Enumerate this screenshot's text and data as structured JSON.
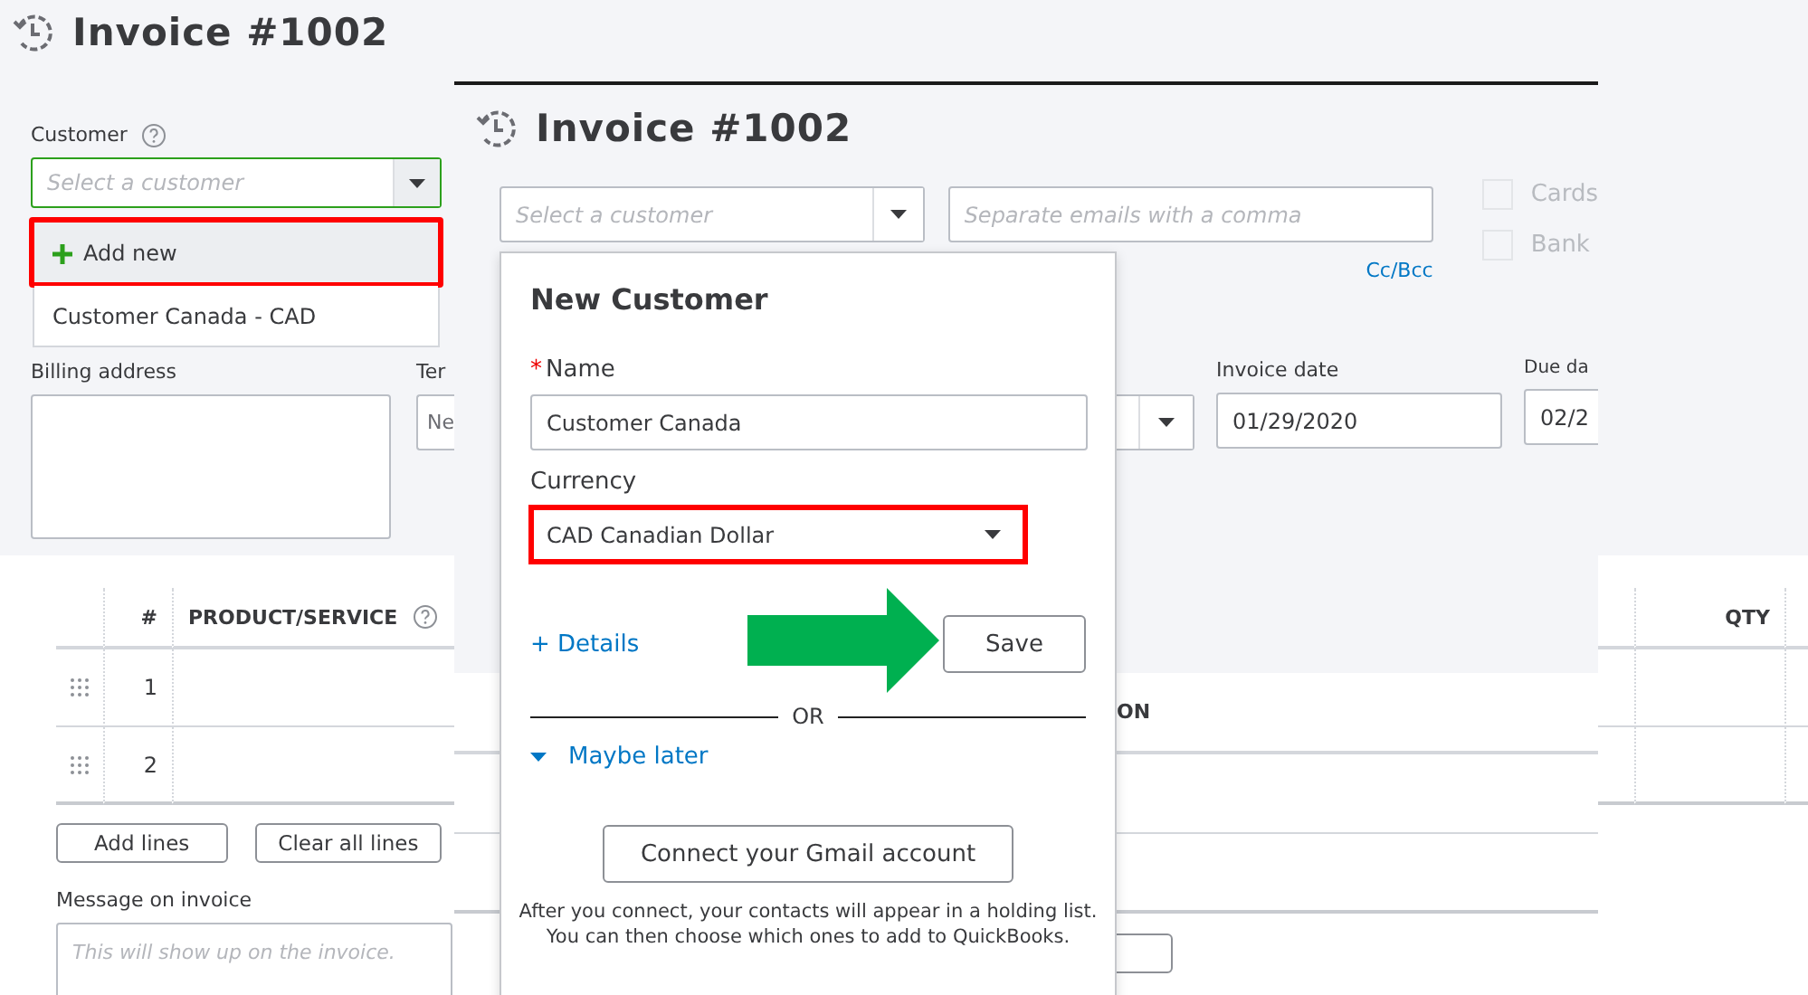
{
  "background_screen": {
    "title": "Invoice #1002",
    "customer": {
      "label": "Customer",
      "placeholder": "Select a customer",
      "dropdown": [
        {
          "label": "Add new",
          "kind": "add",
          "highlighted": true
        },
        {
          "label": "Customer Canada - CAD",
          "kind": "option",
          "highlighted": false
        }
      ]
    },
    "billing_address": {
      "label": "Billing address"
    },
    "terms": {
      "label": "Ter",
      "value": "Ne"
    },
    "table": {
      "columns": [
        "#",
        "PRODUCT/SERVICE",
        "QTY"
      ],
      "rows": [
        {
          "number": "1"
        },
        {
          "number": "2"
        }
      ]
    },
    "buttons": [
      "Add lines",
      "Clear all lines"
    ],
    "message": {
      "label": "Message on invoice",
      "placeholder": "This will show up on the invoice."
    }
  },
  "overlay_screen": {
    "title": "Invoice #1002",
    "customer_placeholder": "Select a customer",
    "email_placeholder": "Separate emails with a comma",
    "cc_bcc": "Cc/Bcc",
    "payment_options": [
      {
        "label": "Cards",
        "checked": false
      },
      {
        "label": "Bank",
        "checked": false
      }
    ],
    "invoice_date": {
      "label": "Invoice date",
      "value": "01/29/2020"
    },
    "due_date": {
      "label": "Due da",
      "value": "02/2"
    },
    "table_header": "ON",
    "dialog": {
      "title": "New Customer",
      "name": {
        "label": "Name",
        "required_mark": "*",
        "value": "Customer Canada"
      },
      "currency": {
        "label": "Currency",
        "value": "CAD Canadian Dollar",
        "highlighted": true
      },
      "details_link": "+ Details",
      "save": "Save",
      "separator": "OR",
      "maybe_later": "Maybe later",
      "connect": "Connect your Gmail account",
      "note": "After you connect, your contacts will appear in a holding list.\nYou can then choose which ones to add to QuickBooks."
    }
  }
}
